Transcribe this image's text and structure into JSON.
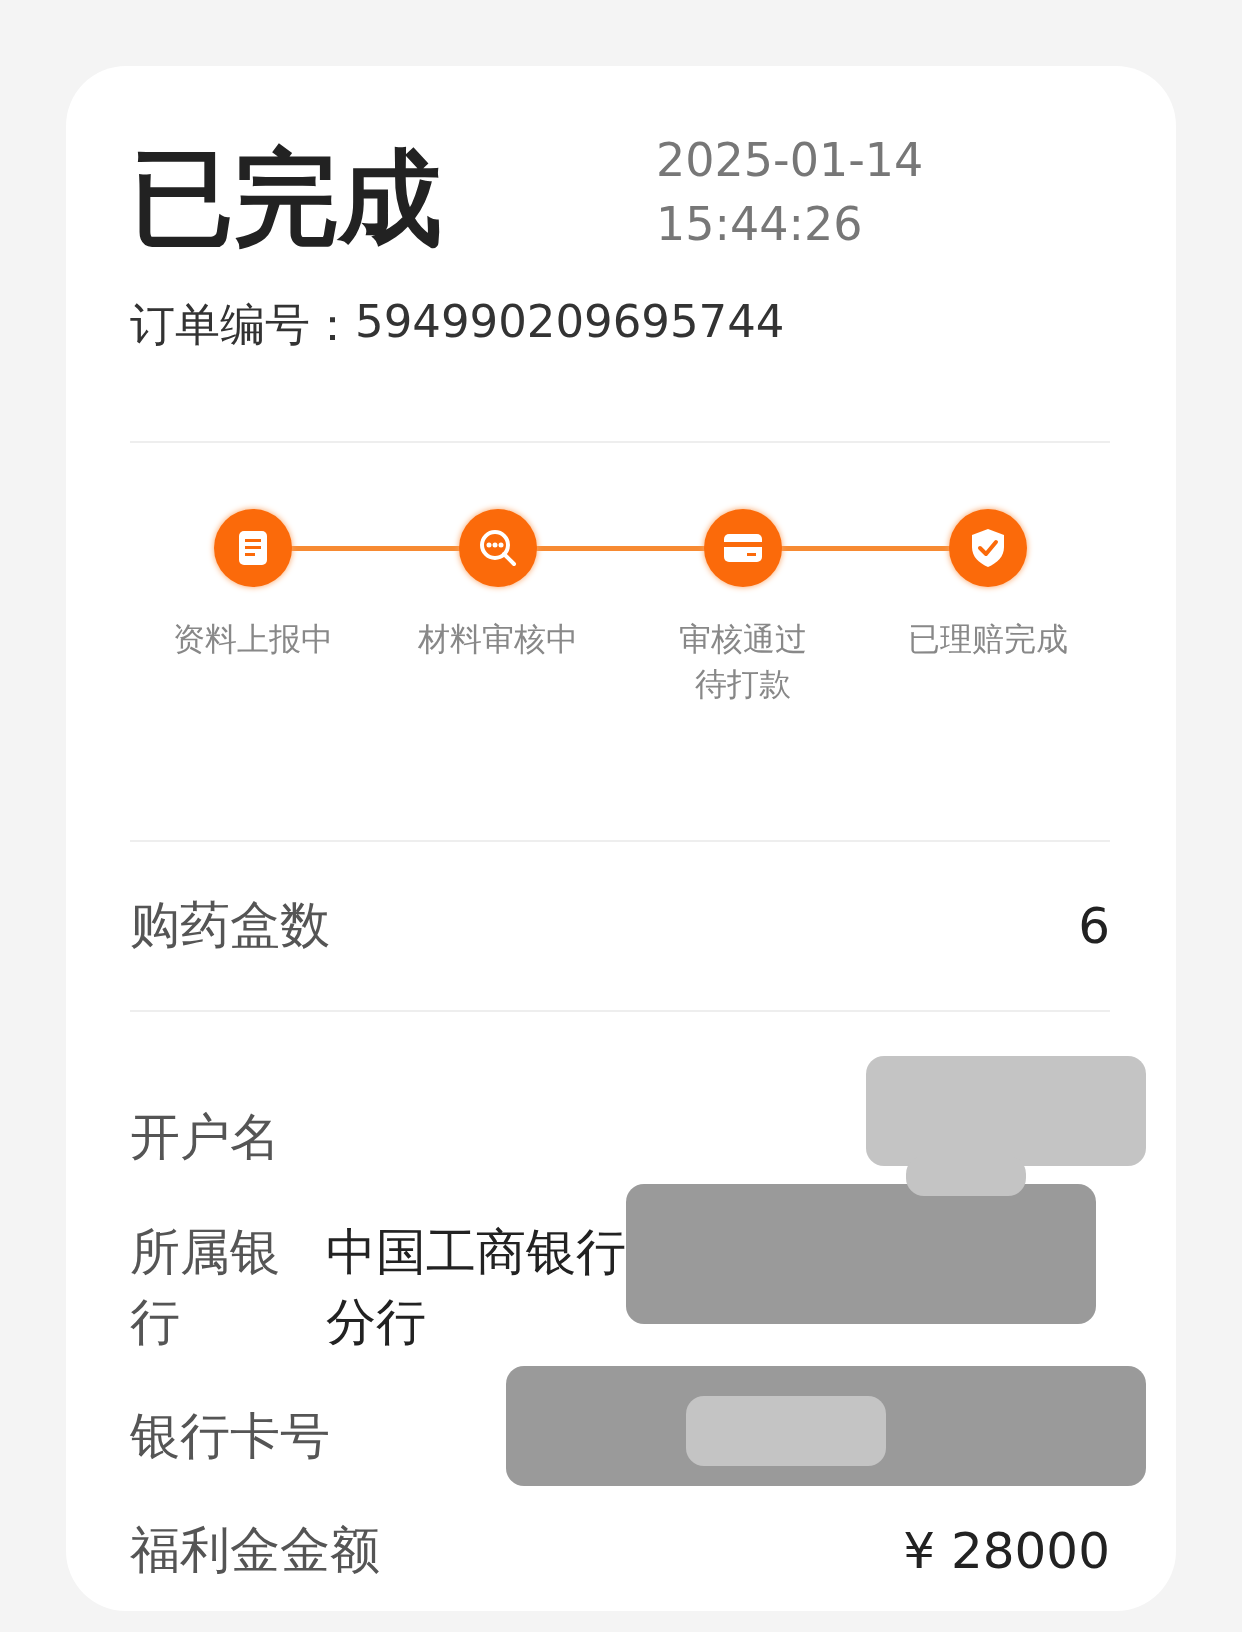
{
  "status": "已完成",
  "datetime": [
    "2025-01-14",
    "15:44:26"
  ],
  "order": {
    "label": "订单编号：",
    "value": "594990209695744"
  },
  "steps": [
    {
      "kind": "document",
      "label_lines": [
        "资料上报中"
      ],
      "done": true
    },
    {
      "kind": "review",
      "label_lines": [
        "材料审核中"
      ],
      "done": true
    },
    {
      "kind": "card",
      "label_lines": [
        "审核通过",
        "待打款"
      ],
      "done": true
    },
    {
      "kind": "shield",
      "label_lines": [
        "已理赔完成"
      ],
      "done": true
    }
  ],
  "box_count": {
    "label": "购药盒数",
    "value": "6"
  },
  "account": {
    "label": "开户名"
  },
  "bank": {
    "label": "所属银行",
    "value_lines": [
      "中国工商银行",
      "分行"
    ]
  },
  "card_number": {
    "label": "银行卡号"
  },
  "amount": {
    "label": "福利金金额",
    "value": "¥ 28000"
  }
}
